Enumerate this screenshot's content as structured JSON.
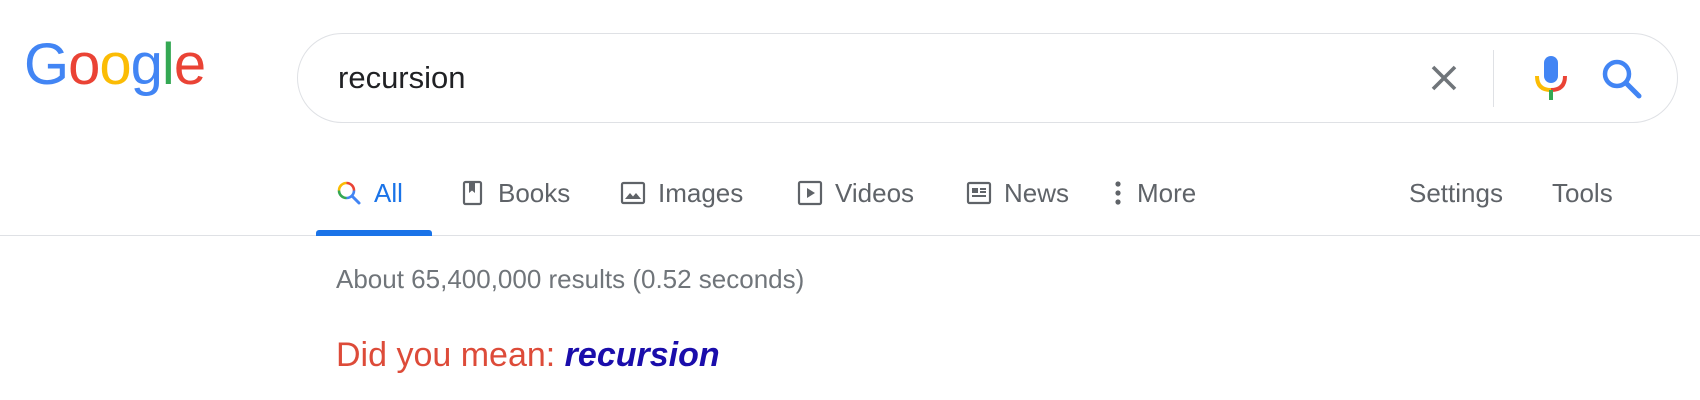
{
  "logo": {
    "letters": [
      "G",
      "o",
      "o",
      "g",
      "l",
      "e"
    ],
    "colors": [
      "#4285F4",
      "#EA4335",
      "#FBBC05",
      "#4285F4",
      "#34A853",
      "#EA4335"
    ]
  },
  "search": {
    "query": "recursion",
    "clear_icon": "close-icon",
    "voice_icon": "microphone-icon",
    "search_icon": "search-icon"
  },
  "tabs": [
    {
      "label": "All",
      "icon": "search-icon",
      "active": true
    },
    {
      "label": "Books",
      "icon": "bookmark-icon",
      "active": false
    },
    {
      "label": "Images",
      "icon": "image-icon",
      "active": false
    },
    {
      "label": "Videos",
      "icon": "play-icon",
      "active": false
    },
    {
      "label": "News",
      "icon": "news-icon",
      "active": false
    },
    {
      "label": "More",
      "icon": "more-vert-icon",
      "active": false
    }
  ],
  "tools": {
    "settings_label": "Settings",
    "tools_label": "Tools"
  },
  "results": {
    "stats": "About 65,400,000 results (0.52 seconds)",
    "did_you_mean_prefix": "Did you mean: ",
    "suggestion": "recursion"
  },
  "colors": {
    "accent": "#1a73e8",
    "link": "#1a0dab",
    "did_you_mean": "#dd4b39",
    "muted": "#5f6368"
  }
}
